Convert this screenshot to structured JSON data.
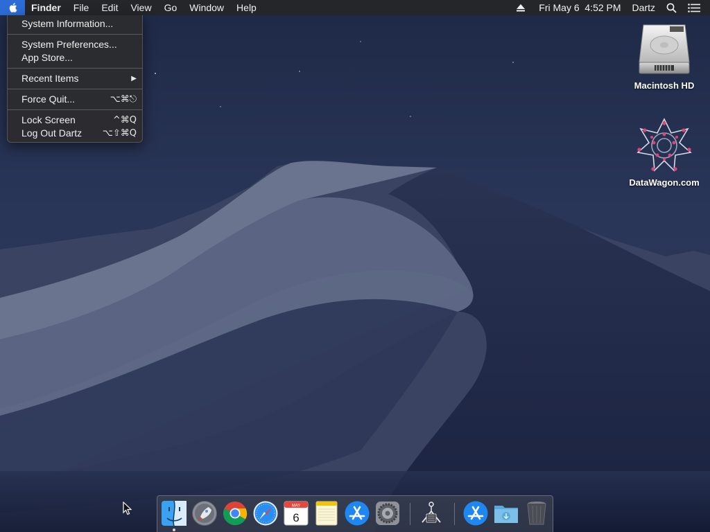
{
  "menubar": {
    "app_name": "Finder",
    "items": [
      "File",
      "Edit",
      "View",
      "Go",
      "Window",
      "Help"
    ],
    "clock": "Fri May 6  4:52 PM",
    "user": "Dartz"
  },
  "apple_menu": {
    "groups": [
      [
        {
          "label": "System Information..."
        }
      ],
      [
        {
          "label": "System Preferences..."
        },
        {
          "label": "App Store..."
        }
      ],
      [
        {
          "label": "Recent Items",
          "submenu": true
        }
      ],
      [
        {
          "label": "Force Quit...",
          "shortcut": "⌥⌘⎋"
        }
      ],
      [
        {
          "label": "Lock Screen",
          "shortcut": "^⌘Q"
        },
        {
          "label": "Log Out Dartz",
          "shortcut": "⌥⇧⌘Q"
        }
      ]
    ],
    "submenu_arrow": "▶"
  },
  "desktop_icons": [
    {
      "label": "Macintosh HD",
      "icon": "hard-drive-icon"
    },
    {
      "label": "DataWagon.com",
      "icon": "datawagon-logo-icon"
    }
  ],
  "dock": {
    "apps": [
      {
        "name": "finder",
        "icon": "finder-icon",
        "running": true
      },
      {
        "name": "launchpad",
        "icon": "launchpad-icon",
        "running": false
      },
      {
        "name": "chrome",
        "icon": "chrome-icon",
        "running": false
      },
      {
        "name": "safari",
        "icon": "safari-icon",
        "running": false
      },
      {
        "name": "calendar",
        "icon": "calendar-icon",
        "running": false
      },
      {
        "name": "notes",
        "icon": "notes-icon",
        "running": false
      },
      {
        "name": "app-store",
        "icon": "app-store-icon",
        "running": false
      },
      {
        "name": "system-preferences",
        "icon": "system-preferences-icon",
        "running": false
      },
      {
        "name": "network-utility",
        "icon": "network-utility-icon",
        "running": false
      },
      {
        "name": "app-store-download",
        "icon": "app-store-icon",
        "running": false
      },
      {
        "name": "downloads",
        "icon": "downloads-folder-icon",
        "running": false
      },
      {
        "name": "trash",
        "icon": "trash-icon",
        "running": false
      }
    ],
    "calendar_month": "MAY",
    "calendar_day": "6"
  },
  "colors": {
    "menu_highlight": "#2d6cd6",
    "menubar_bg": "#262628",
    "sky": "#263252"
  }
}
